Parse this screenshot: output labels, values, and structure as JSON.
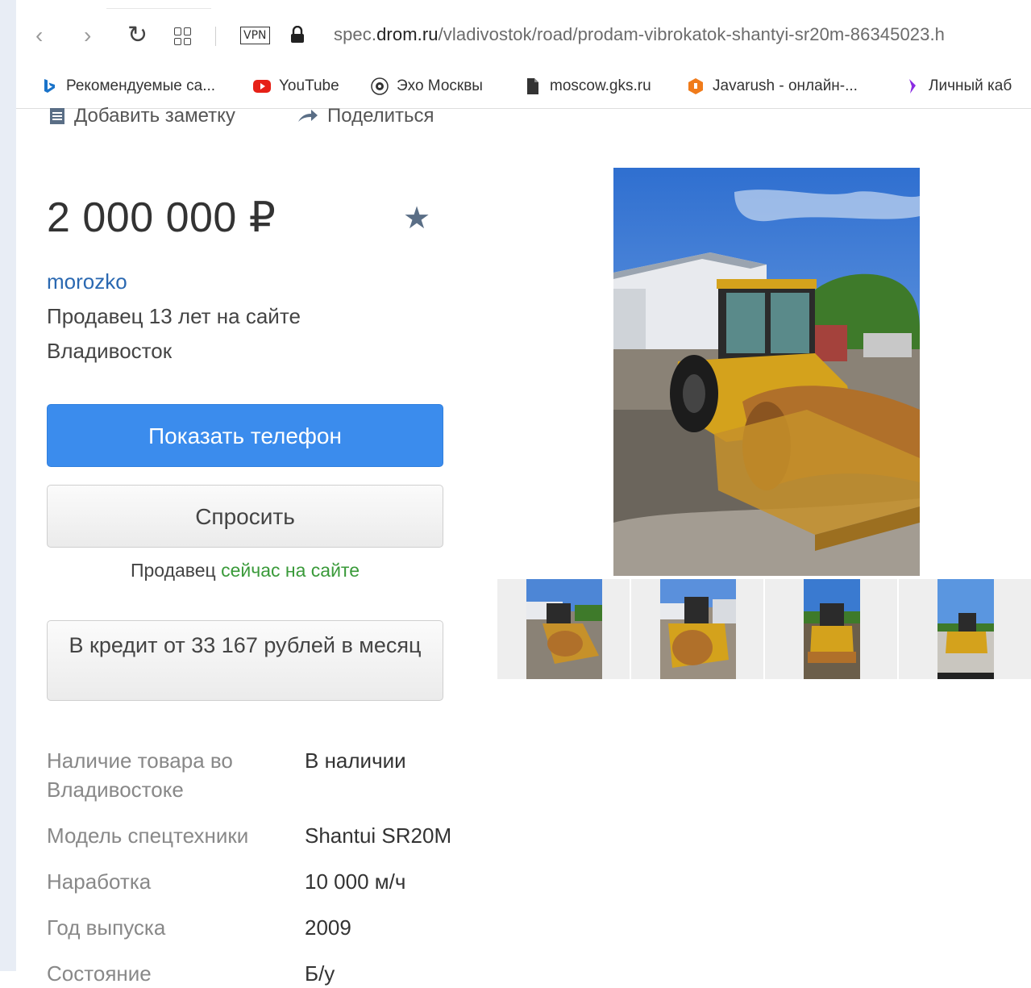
{
  "browser": {
    "url_host": "spec.",
    "url_domain": "drom.ru",
    "url_path": "/vladivostok/road/prodam-vibrokatok-shantyi-sr20m-86345023.h",
    "vpn_label": "VPN",
    "icons": [
      "back-icon",
      "forward-icon",
      "reload-icon",
      "apps-icon",
      "lock-icon"
    ]
  },
  "bookmarks": [
    {
      "label": "Рекомендуемые са...",
      "icon": "bing-icon",
      "color": "#1a73c9"
    },
    {
      "label": "YouTube",
      "icon": "youtube-icon",
      "color": "#e62117"
    },
    {
      "label": "Эхо Москвы",
      "icon": "echo-icon",
      "color": "#333333"
    },
    {
      "label": "moscow.gks.ru",
      "icon": "file-icon",
      "color": "#333333"
    },
    {
      "label": "Javarush - онлайн-...",
      "icon": "javarush-icon",
      "color": "#f07b1a"
    },
    {
      "label": "Личный каб",
      "icon": "rocket-icon",
      "color": "#8a2be2"
    }
  ],
  "actions": {
    "add_note": "Добавить заметку",
    "share": "Поделиться"
  },
  "listing": {
    "price": "2 000 000 ₽",
    "seller_name": "morozko",
    "seller_since": "Продавец 13 лет на сайте",
    "city": "Владивосток",
    "show_phone": "Показать телефон",
    "ask": "Спросить",
    "online_prefix": "Продавец",
    "online_status": "сейчас на сайте",
    "credit": "В кредит от 33 167 рублей в месяц"
  },
  "specs": [
    {
      "label": "Наличие товара во Владивостоке",
      "value": "В наличии"
    },
    {
      "label": "Модель спецтехники",
      "value": "Shantui SR20M"
    },
    {
      "label": "Наработка",
      "value": "10 000 м/ч"
    },
    {
      "label": "Год выпуска",
      "value": "2009"
    },
    {
      "label": "Состояние",
      "value": "Б/у"
    }
  ],
  "colors": {
    "accent": "#3b8ced",
    "link": "#2a68b1",
    "online": "#3a9a3a"
  }
}
